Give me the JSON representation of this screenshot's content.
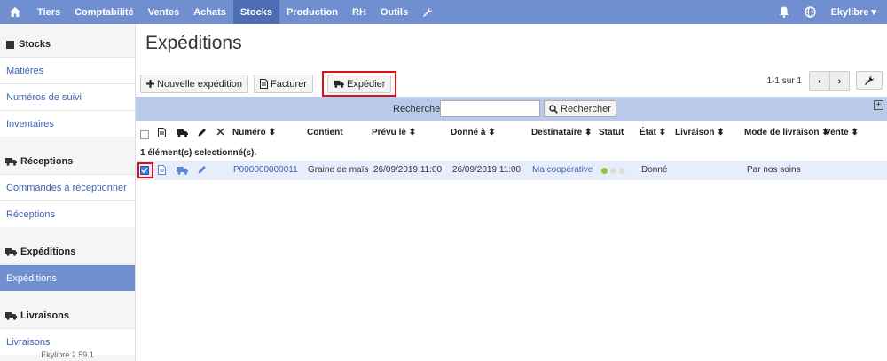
{
  "topnav": {
    "items": [
      "Tiers",
      "Comptabilité",
      "Ventes",
      "Achats",
      "Stocks",
      "Production",
      "RH",
      "Outils"
    ],
    "active": "Stocks",
    "user": "Ekylibre"
  },
  "sidebar": {
    "sections": [
      {
        "title": "Stocks",
        "icon": "cube-icon",
        "links": [
          "Matières",
          "Numéros de suivi",
          "Inventaires"
        ]
      },
      {
        "title": "Réceptions",
        "icon": "truck-icon",
        "links": [
          "Commandes à réceptionner",
          "Réceptions"
        ]
      },
      {
        "title": "Expéditions",
        "icon": "truck-icon",
        "links": [
          "Expéditions"
        ]
      },
      {
        "title": "Livraisons",
        "icon": "truck-icon",
        "links": [
          "Livraisons"
        ]
      }
    ],
    "active_link": "Expéditions",
    "version": "Ekylibre 2.59.1"
  },
  "page": {
    "title": "Expéditions"
  },
  "toolbar": {
    "new_label": "Nouvelle expédition",
    "invoice_label": "Facturer",
    "ship_label": "Expédier"
  },
  "pager": {
    "text": "1-1 sur 1"
  },
  "search": {
    "label": "Rechercher",
    "button": "Rechercher",
    "value": ""
  },
  "table": {
    "columns": [
      "Numéro",
      "Contient",
      "Prévu le",
      "Donné à",
      "Destinataire",
      "Statut",
      "État",
      "Livraison",
      "Mode de livraison",
      "Vente"
    ],
    "selected_text": "1 élément(s) selectionné(s).",
    "rows": [
      {
        "numero": "P000000000011",
        "contient": "Graine de maïs",
        "prevu": "26/09/2019 11:00",
        "donne": "26/09/2019 11:00",
        "destinataire": "Ma coopérative",
        "etat": "Donné",
        "livraison": "",
        "mode": "Par nos soins",
        "vente": "",
        "status_colors": [
          "#8cc63f",
          "#dddddd",
          "#dddddd"
        ],
        "checked": true
      }
    ]
  },
  "colors": {
    "nav": "#6f8fd1",
    "nav_active": "#4d6cb3",
    "search_bar": "#b8c9ea",
    "highlight": "#dd1111",
    "link": "#3b63b7"
  }
}
